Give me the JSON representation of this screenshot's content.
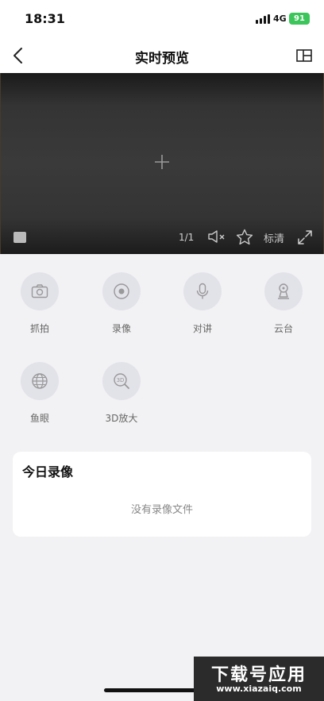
{
  "status_bar": {
    "time": "18:31",
    "network": "4G",
    "battery": "91"
  },
  "nav": {
    "title": "实时预览"
  },
  "video": {
    "page_indicator": "1/1",
    "quality": "标清"
  },
  "functions": [
    {
      "label": "抓拍",
      "icon": "camera-icon"
    },
    {
      "label": "录像",
      "icon": "record-icon"
    },
    {
      "label": "对讲",
      "icon": "microphone-icon"
    },
    {
      "label": "云台",
      "icon": "ptz-icon"
    },
    {
      "label": "鱼眼",
      "icon": "fisheye-icon"
    },
    {
      "label": "3D放大",
      "icon": "3d-zoom-icon"
    }
  ],
  "recordings": {
    "title": "今日录像",
    "empty": "没有录像文件"
  },
  "watermark": {
    "top": "下载号应用",
    "bottom": "www.xiazaiq.com"
  }
}
